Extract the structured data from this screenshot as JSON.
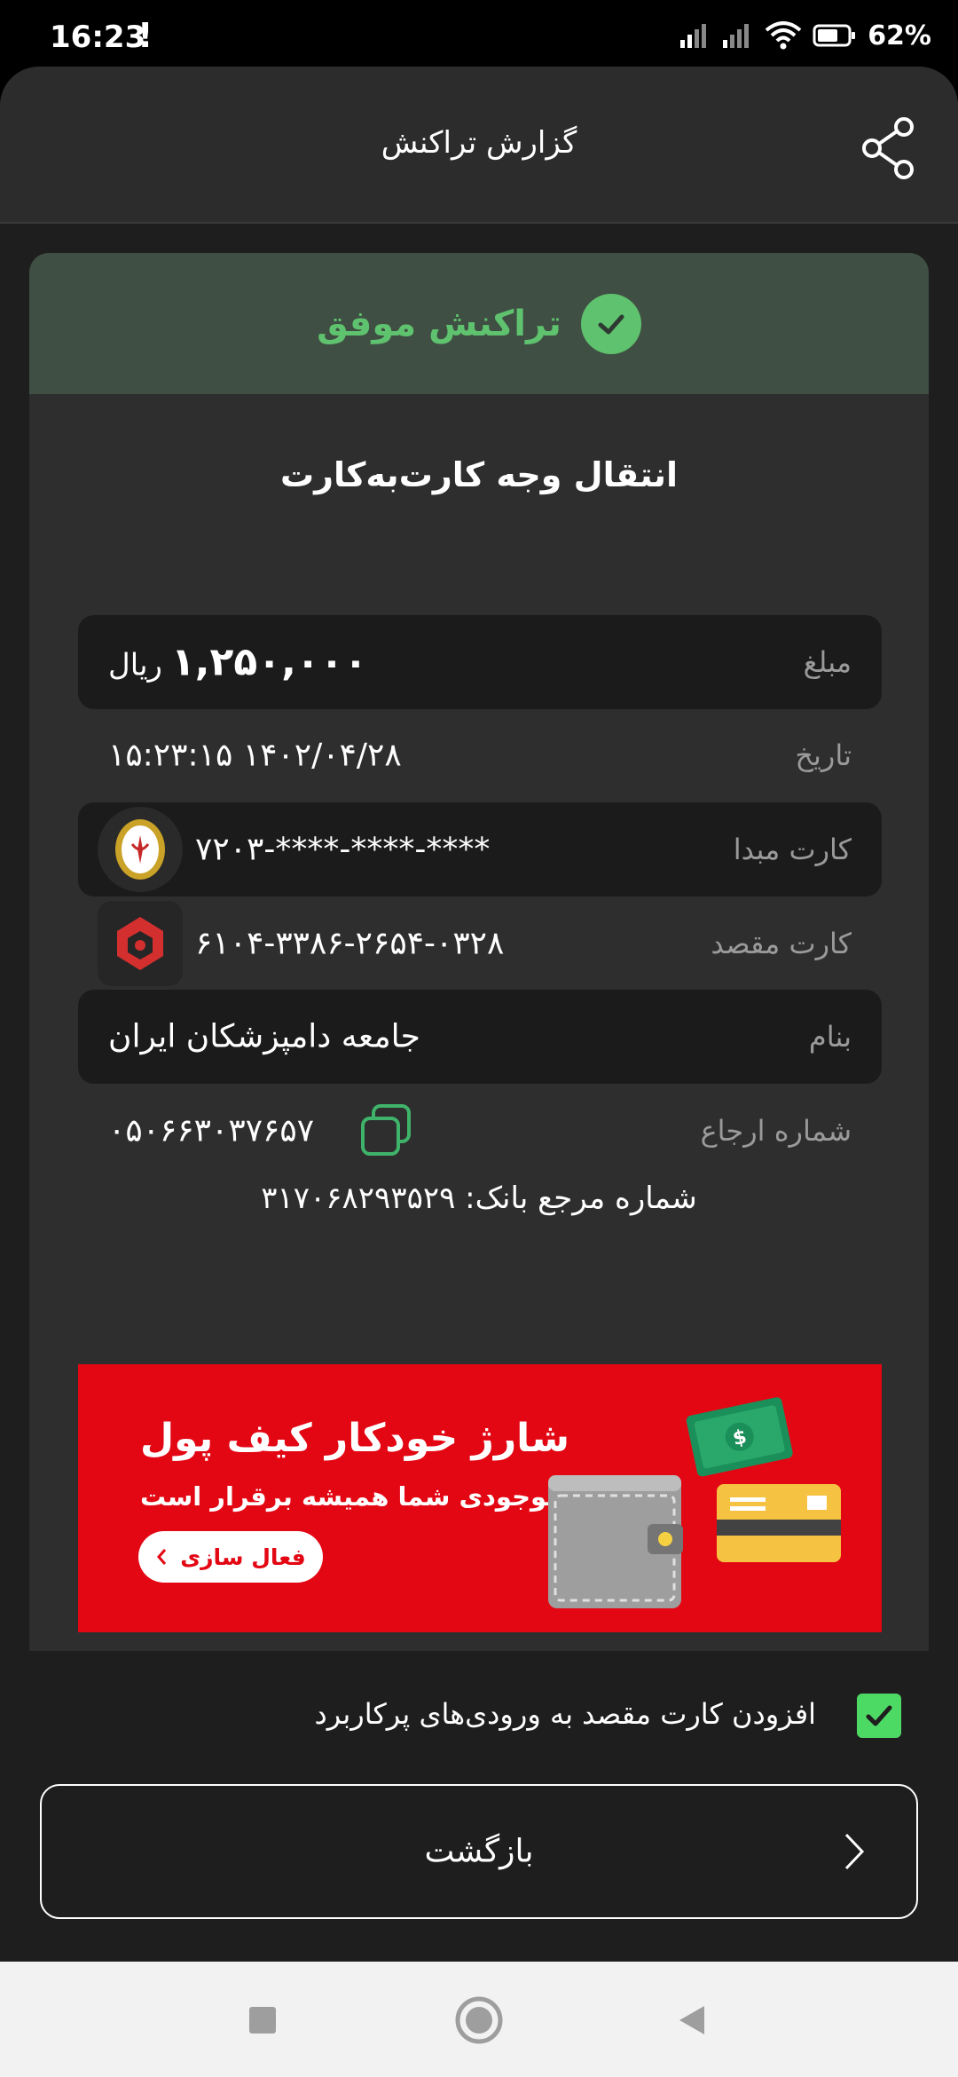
{
  "status_bar": {
    "time": "16:23",
    "alert": "!",
    "battery": "62%"
  },
  "header": {
    "title": "گزارش تراکنش"
  },
  "receipt": {
    "status": "تراکنش موفق",
    "type": "انتقال وجه کارت‌به‌کارت",
    "amount_label": "مبلغ",
    "amount_value": "۱,۲۵۰,۰۰۰",
    "amount_unit": "ریال",
    "date_label": "تاریخ",
    "date_value": "۱۴۰۲/۰۴/۲۸  ۱۵:۲۳:۱۵",
    "source_label": "کارت مبدا",
    "source_value": "****-****-****-۷۲۰۳",
    "dest_label": "کارت مقصد",
    "dest_value": "۶۱۰۴-۳۳۸۶-۲۶۵۴-۰۳۲۸",
    "name_label": "بنام",
    "name_value": "جامعه دامپزشکان ایران",
    "ref_label": "شماره ارجاع",
    "ref_value": "۰۵۰۶۶۳۰۳۷۶۵۷",
    "bank_ref": "شماره مرجع بانک: ۳۱۷۰۶۸۲۹۳۵۲۹"
  },
  "promo": {
    "title": "شارژ خودکار کیف پول",
    "subtitle": "موجودی شما همیشه برقرار است",
    "button": "فعال سازی"
  },
  "bottom": {
    "checkbox_label": "افزودن کارت مقصد به ورودی‌های پرکاربرد",
    "back_button": "بازگشت"
  },
  "colors": {
    "success_green": "#5fc26e",
    "promo_red": "#e30613",
    "checkbox_green": "#4cd964"
  }
}
